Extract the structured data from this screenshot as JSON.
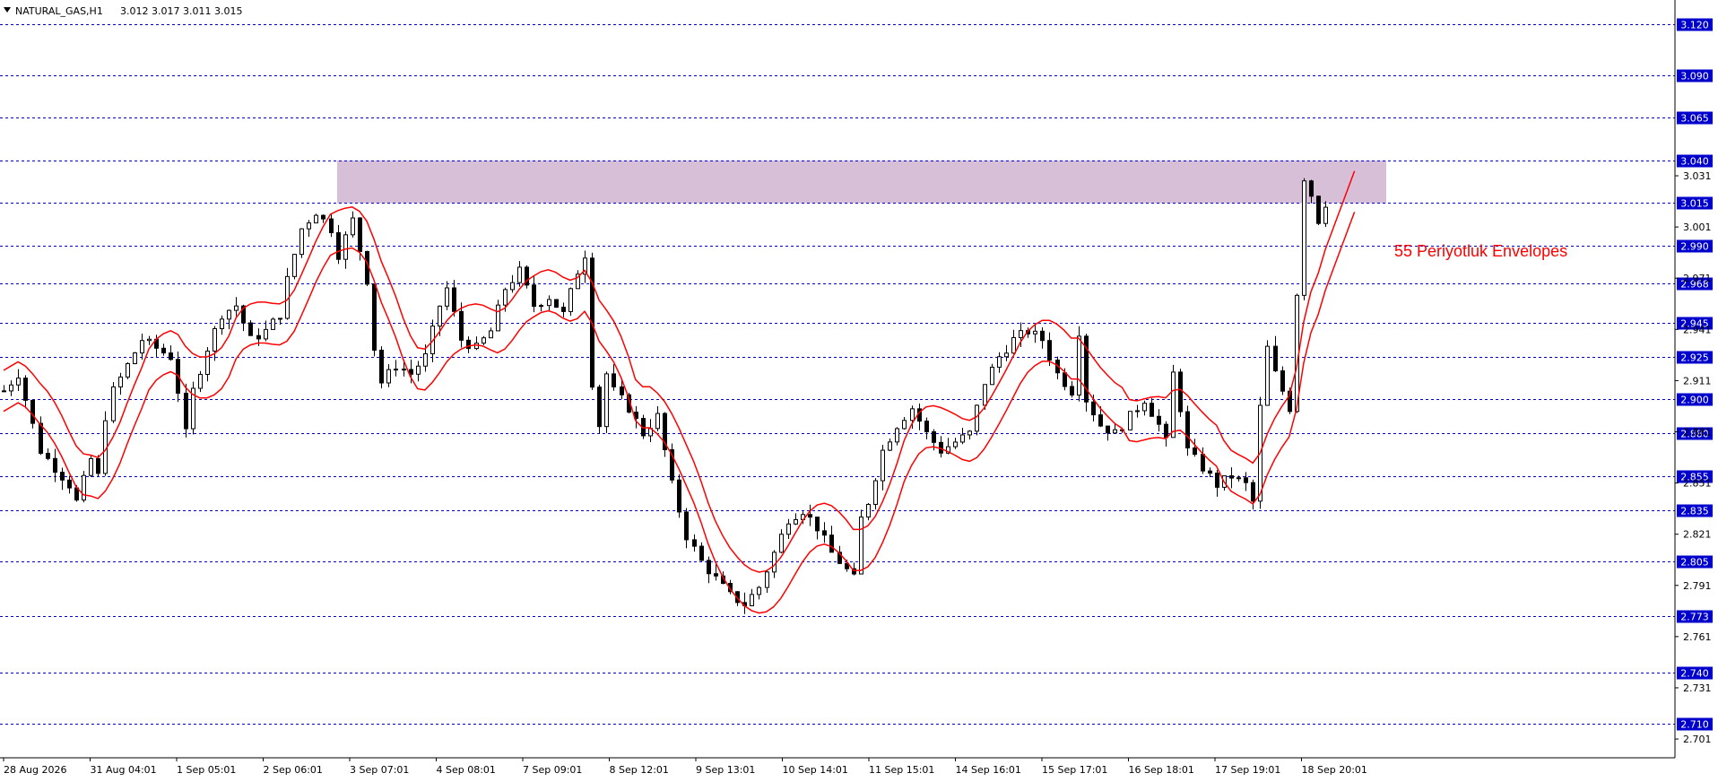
{
  "chart_data": {
    "type": "candlestick",
    "header": {
      "symbol": "NATURAL_GAS,H1",
      "ohlc_text": "3.012 3.017 3.011 3.015",
      "open": 3.012,
      "high": 3.017,
      "low": 3.011,
      "close": 3.015
    },
    "y_range": [
      2.69,
      3.134
    ],
    "y_ticks": [
      3.031,
      3.001,
      2.971,
      2.941,
      2.911,
      2.881,
      2.851,
      2.821,
      2.791,
      2.761,
      2.731,
      2.701
    ],
    "y_tick_labels": [
      "3.031",
      "3.001",
      "2.971",
      "2.941",
      "2.911",
      "2.881",
      "2.851",
      "2.821",
      "2.791",
      "2.761",
      "2.731",
      "2.701"
    ],
    "x_labels": [
      "28 Aug 2026",
      "31 Aug 04:01",
      "1 Sep 05:01",
      "2 Sep 06:01",
      "3 Sep 07:01",
      "4 Sep 08:01",
      "7 Sep 09:01",
      "8 Sep 12:01",
      "9 Sep 13:01",
      "10 Sep 14:01",
      "11 Sep 15:01",
      "14 Sep 16:01",
      "15 Sep 17:01",
      "16 Sep 18:01",
      "17 Sep 19:01",
      "18 Sep 20:01"
    ],
    "horizontal_levels": [
      {
        "value": 3.12,
        "label": "3.120"
      },
      {
        "value": 3.09,
        "label": "3.090"
      },
      {
        "value": 3.065,
        "label": "3.065"
      },
      {
        "value": 3.04,
        "label": "3.040"
      },
      {
        "value": 3.015,
        "label": "3.015"
      },
      {
        "value": 2.99,
        "label": "2.990"
      },
      {
        "value": 2.968,
        "label": "2.968"
      },
      {
        "value": 2.945,
        "label": "2.945"
      },
      {
        "value": 2.925,
        "label": "2.925"
      },
      {
        "value": 2.9,
        "label": "2.900"
      },
      {
        "value": 2.88,
        "label": "2.880"
      },
      {
        "value": 2.855,
        "label": "2.855"
      },
      {
        "value": 2.835,
        "label": "2.835"
      },
      {
        "value": 2.805,
        "label": "2.805"
      },
      {
        "value": 2.773,
        "label": "2.773"
      },
      {
        "value": 2.74,
        "label": "2.740"
      },
      {
        "value": 2.71,
        "label": "2.710"
      }
    ],
    "resistance_zone": {
      "from_value": 3.015,
      "to_value": 3.04,
      "color": "#d8bfd8"
    },
    "annotation": {
      "text": "55 Periyotluk Envelopes",
      "color": "#ff0000"
    },
    "price_path": [
      [
        0,
        2.905
      ],
      [
        2,
        2.915
      ],
      [
        4,
        2.885
      ],
      [
        5,
        2.87
      ],
      [
        7,
        2.86
      ],
      [
        9,
        2.85
      ],
      [
        10,
        2.84
      ],
      [
        12,
        2.865
      ],
      [
        13,
        2.855
      ],
      [
        14,
        2.89
      ],
      [
        15,
        2.905
      ],
      [
        17,
        2.92
      ],
      [
        19,
        2.935
      ],
      [
        21,
        2.93
      ],
      [
        23,
        2.925
      ],
      [
        24,
        2.905
      ],
      [
        25,
        2.88
      ],
      [
        26,
        2.905
      ],
      [
        28,
        2.93
      ],
      [
        30,
        2.95
      ],
      [
        32,
        2.955
      ],
      [
        33,
        2.945
      ],
      [
        34,
        2.935
      ],
      [
        36,
        2.94
      ],
      [
        38,
        2.95
      ],
      [
        39,
        2.97
      ],
      [
        41,
        3.0
      ],
      [
        43,
        3.01
      ],
      [
        45,
        3.0
      ],
      [
        46,
        2.985
      ],
      [
        48,
        3.005
      ],
      [
        50,
        2.97
      ],
      [
        51,
        2.93
      ],
      [
        52,
        2.91
      ],
      [
        54,
        2.92
      ],
      [
        56,
        2.915
      ],
      [
        58,
        2.925
      ],
      [
        60,
        2.955
      ],
      [
        61,
        2.965
      ],
      [
        63,
        2.935
      ],
      [
        65,
        2.93
      ],
      [
        67,
        2.94
      ],
      [
        69,
        2.965
      ],
      [
        71,
        2.975
      ],
      [
        73,
        2.955
      ],
      [
        75,
        2.96
      ],
      [
        77,
        2.95
      ],
      [
        79,
        2.975
      ],
      [
        80,
        2.985
      ],
      [
        81,
        2.91
      ],
      [
        82,
        2.885
      ],
      [
        83,
        2.915
      ],
      [
        84,
        2.905
      ],
      [
        86,
        2.895
      ],
      [
        88,
        2.88
      ],
      [
        90,
        2.89
      ],
      [
        92,
        2.85
      ],
      [
        94,
        2.82
      ],
      [
        96,
        2.805
      ],
      [
        98,
        2.795
      ],
      [
        100,
        2.785
      ],
      [
        102,
        2.78
      ],
      [
        104,
        2.79
      ],
      [
        106,
        2.81
      ],
      [
        108,
        2.83
      ],
      [
        110,
        2.835
      ],
      [
        112,
        2.825
      ],
      [
        114,
        2.81
      ],
      [
        116,
        2.8
      ],
      [
        117,
        2.795
      ],
      [
        118,
        2.83
      ],
      [
        119,
        2.84
      ],
      [
        121,
        2.87
      ],
      [
        123,
        2.885
      ],
      [
        125,
        2.895
      ],
      [
        127,
        2.88
      ],
      [
        129,
        2.87
      ],
      [
        131,
        2.875
      ],
      [
        133,
        2.88
      ],
      [
        135,
        2.91
      ],
      [
        137,
        2.925
      ],
      [
        139,
        2.935
      ],
      [
        141,
        2.94
      ],
      [
        143,
        2.935
      ],
      [
        145,
        2.915
      ],
      [
        147,
        2.905
      ],
      [
        148,
        2.94
      ],
      [
        149,
        2.9
      ],
      [
        151,
        2.885
      ],
      [
        153,
        2.88
      ],
      [
        155,
        2.89
      ],
      [
        157,
        2.9
      ],
      [
        159,
        2.885
      ],
      [
        160,
        2.875
      ],
      [
        161,
        2.915
      ],
      [
        162,
        2.895
      ],
      [
        163,
        2.87
      ],
      [
        165,
        2.86
      ],
      [
        167,
        2.85
      ],
      [
        169,
        2.855
      ],
      [
        171,
        2.85
      ],
      [
        172,
        2.84
      ],
      [
        173,
        2.895
      ],
      [
        174,
        2.93
      ],
      [
        175,
        2.915
      ],
      [
        176,
        2.905
      ],
      [
        177,
        2.895
      ],
      [
        179,
        3.03
      ],
      [
        180,
        3.02
      ],
      [
        181,
        3.005
      ],
      [
        182,
        3.015
      ]
    ],
    "envelope_period": 55,
    "envelope_offset": 0.012,
    "envelope_color": "#ff0000",
    "grid_color": "#0000cd",
    "label_bg": "#0000cd",
    "label_text_color": "#ffffff",
    "background": "#ffffff"
  }
}
